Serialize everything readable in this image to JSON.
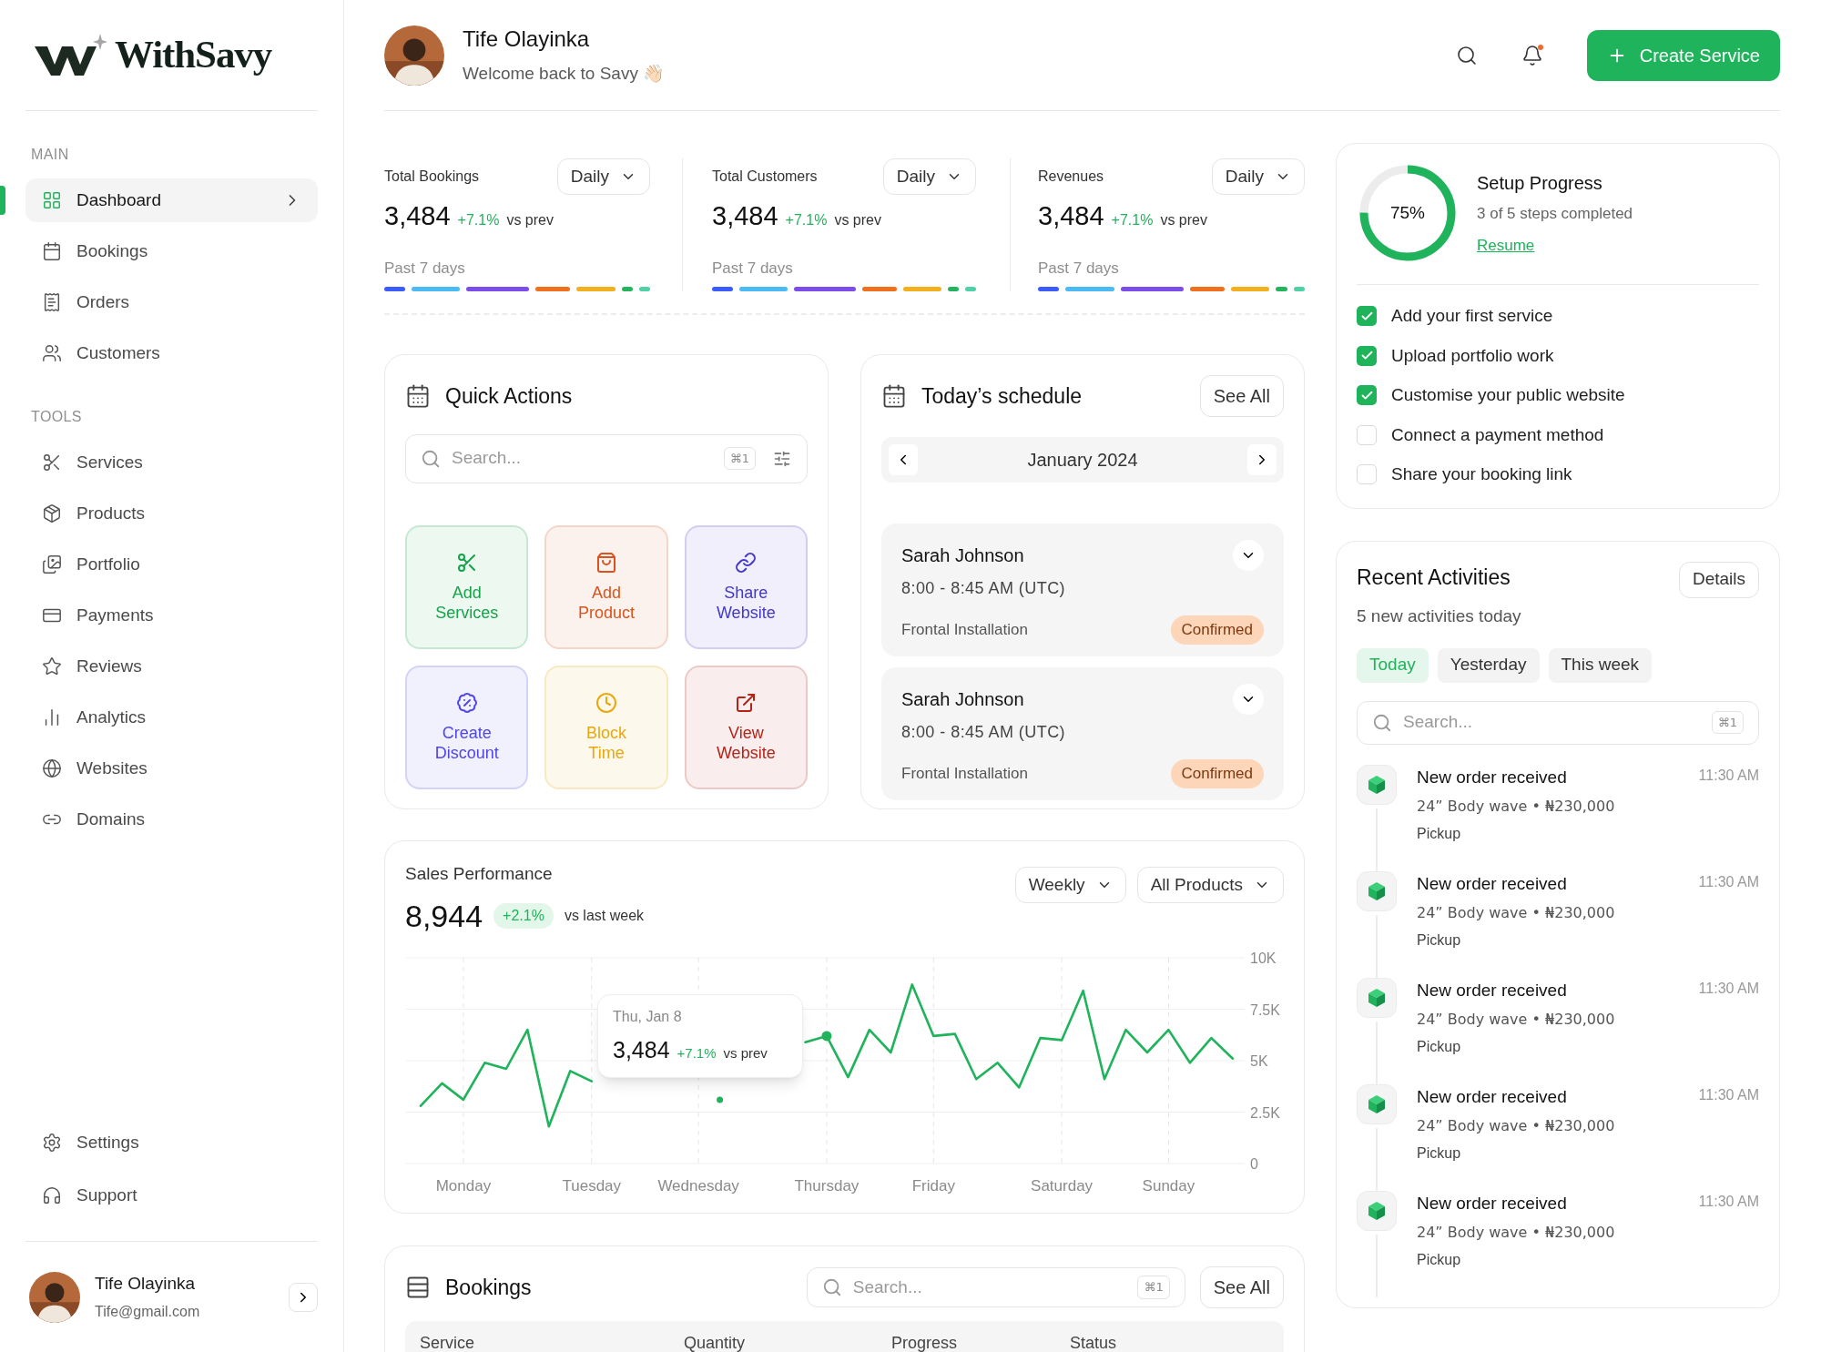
{
  "sidebar": {
    "logo": "WithSavy",
    "sections": [
      {
        "heading": "MAIN",
        "items": [
          {
            "label": "Dashboard",
            "selected": true
          },
          {
            "label": "Bookings",
            "selected": false
          },
          {
            "label": "Orders",
            "selected": false
          },
          {
            "label": "Customers",
            "selected": false
          }
        ]
      },
      {
        "heading": "TOOLS",
        "items": [
          {
            "label": "Services",
            "selected": false
          },
          {
            "label": "Products",
            "selected": false
          },
          {
            "label": "Portfolio",
            "selected": false
          },
          {
            "label": "Payments",
            "selected": false
          },
          {
            "label": "Reviews",
            "selected": false
          },
          {
            "label": "Analytics",
            "selected": false
          },
          {
            "label": "Websites",
            "selected": false
          },
          {
            "label": "Domains",
            "selected": false
          }
        ]
      }
    ],
    "footer_items": [
      {
        "label": "Settings"
      },
      {
        "label": "Support"
      }
    ],
    "user": {
      "name": "Tife Olayinka",
      "email": "Tife@gmail.com"
    }
  },
  "header": {
    "name": "Tife Olayinka",
    "greeting": "Welcome back to Savy 👋🏻",
    "create_button": "Create Service"
  },
  "stats": [
    {
      "label": "Total Bookings",
      "period": "Daily",
      "value": "3,484",
      "change": "+7.1%",
      "comparison": "vs prev",
      "footnote": "Past 7 days"
    },
    {
      "label": "Total Customers",
      "period": "Daily",
      "value": "3,484",
      "change": "+7.1%",
      "comparison": "vs prev",
      "footnote": "Past 7 days"
    },
    {
      "label": "Revenues",
      "period": "Daily",
      "value": "3,484",
      "change": "+7.1%",
      "comparison": "vs prev",
      "footnote": "Past 7 days"
    }
  ],
  "quick_actions": {
    "title": "Quick Actions",
    "search": {
      "placeholder": "Search...",
      "shortcut": "⌘1"
    },
    "actions": [
      {
        "label": "Add Services",
        "color": "#16a34a"
      },
      {
        "label": "Add Product",
        "color": "#d9531e"
      },
      {
        "label": "Share Website",
        "color": "#4338ca"
      },
      {
        "label": "Create Discount",
        "color": "#4f46e5"
      },
      {
        "label": "Block Time",
        "color": "#eaa70c"
      },
      {
        "label": "View Website",
        "color": "#b42318"
      }
    ]
  },
  "schedule": {
    "title": "Today’s schedule",
    "see_all": "See All",
    "month": "January 2024",
    "entries": [
      {
        "name": "Sarah Johnson",
        "time": "8:00 - 8:45 AM (UTC)",
        "service": "Frontal Installation",
        "status": "Confirmed"
      },
      {
        "name": "Sarah Johnson",
        "time": "8:00 - 8:45 AM (UTC)",
        "service": "Frontal Installation",
        "status": "Confirmed"
      }
    ]
  },
  "sales": {
    "title": "Sales Performance",
    "value": "8,944",
    "change": "+2.1%",
    "comparison": "vs last week",
    "period": "Weekly",
    "filter": "All Products",
    "tooltip": {
      "date": "Thu, Jan 8",
      "value": "3,484",
      "change": "+7.1%",
      "comparison": "vs prev"
    },
    "chart_data": {
      "type": "line",
      "categories": [
        null,
        null,
        "Monday",
        null,
        null,
        null,
        null,
        null,
        "Tuesday",
        null,
        null,
        null,
        null,
        "Wednesday",
        null,
        null,
        null,
        null,
        null,
        "Thursday",
        null,
        null,
        null,
        null,
        "Friday",
        null,
        null,
        null,
        null,
        null,
        "Saturday",
        null,
        null,
        null,
        null,
        "Sunday",
        null,
        null,
        null
      ],
      "series": [
        {
          "color": "#1fb35b",
          "values": [
            2800,
            3900,
            3100,
            4900,
            4600,
            6500,
            1800,
            4500,
            4000,
            null,
            null,
            null,
            null,
            null,
            3100,
            null,
            null,
            null,
            5900,
            6200,
            4200,
            6500,
            5400,
            8700,
            6200,
            6300,
            4100,
            4900,
            3700,
            6100,
            6000,
            8400,
            4100,
            6500,
            5400,
            6500,
            4900,
            6100,
            5100
          ]
        }
      ],
      "ylim": [
        0,
        10000
      ],
      "grid": true,
      "yticks": [
        {
          "value": 0,
          "label": "0"
        },
        {
          "value": 2500,
          "label": "2.5K"
        },
        {
          "value": 5000,
          "label": "5K"
        },
        {
          "value": 7500,
          "label": "7.5K"
        },
        {
          "value": 10000,
          "label": "10K"
        }
      ]
    }
  },
  "bookings": {
    "title": "Bookings",
    "search": {
      "placeholder": "Search...",
      "shortcut": "⌘1"
    },
    "see_all": "See All",
    "columns": [
      "Service",
      "Quantity",
      "Progress",
      "Status"
    ]
  },
  "setup": {
    "percent": "75%",
    "level": 0.75,
    "title": "Setup Progress",
    "subtitle": "3 of 5 steps completed",
    "resume": "Resume",
    "steps": [
      {
        "label": "Add your first service",
        "checked": true
      },
      {
        "label": "Upload portfolio work",
        "checked": true
      },
      {
        "label": "Customise your public website",
        "checked": true
      },
      {
        "label": "Connect a payment method",
        "checked": false
      },
      {
        "label": "Share your booking link",
        "checked": false
      }
    ]
  },
  "activities": {
    "title": "Recent Activities",
    "details": "Details",
    "subtitle": "5 new activities today",
    "tabs": [
      {
        "label": "Today",
        "selected": true
      },
      {
        "label": "Yesterday",
        "selected": false
      },
      {
        "label": "This week",
        "selected": false
      }
    ],
    "search": {
      "placeholder": "Search...",
      "shortcut": "⌘1"
    },
    "items": [
      {
        "title": "New order received",
        "detail": "24” Body wave • ₦230,000",
        "method": "Pickup",
        "time": "11:30 AM"
      },
      {
        "title": "New order received",
        "detail": "24” Body wave • ₦230,000",
        "method": "Pickup",
        "time": "11:30 AM"
      },
      {
        "title": "New order received",
        "detail": "24” Body wave • ₦230,000",
        "method": "Pickup",
        "time": "11:30 AM"
      },
      {
        "title": "New order received",
        "detail": "24” Body wave • ₦230,000",
        "method": "Pickup",
        "time": "11:30 AM"
      },
      {
        "title": "New order received",
        "detail": "24” Body wave • ₦230,000",
        "method": "Pickup",
        "time": "11:30 AM"
      }
    ]
  }
}
